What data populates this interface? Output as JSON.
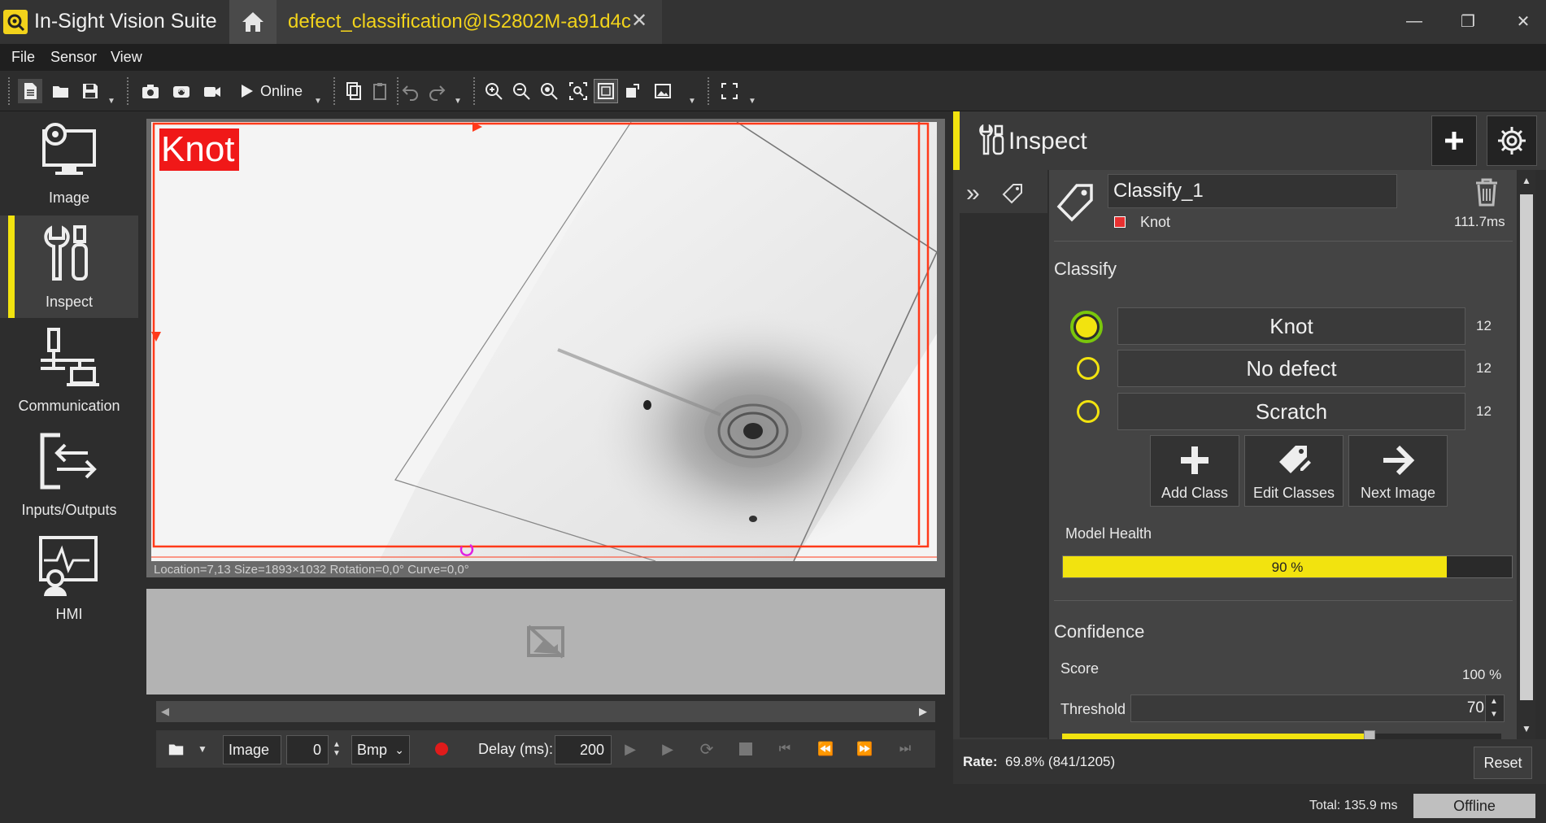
{
  "app": {
    "title": "In-Sight Vision Suite",
    "document_tab": "defect_classification@IS2802M-a91d4c",
    "accent_color": "#f2e30f"
  },
  "menu": {
    "items": [
      "File",
      "Sensor",
      "View"
    ]
  },
  "toolbar": {
    "online_label": "Online",
    "icons": [
      "new-file-icon",
      "open-folder-icon",
      "save-icon",
      "trigger-camera-icon",
      "live-video-icon",
      "record-icon",
      "play-icon",
      "copy-icon",
      "paste-icon",
      "undo-icon",
      "redo-icon",
      "zoom-in-icon",
      "zoom-out-icon",
      "zoom-fit-icon",
      "zoom-selection-icon",
      "zoom-fill-icon",
      "rotate-image-icon",
      "image-icon",
      "fullscreen-icon"
    ]
  },
  "nav": {
    "items": [
      {
        "label": "Image",
        "icon": "monitor-gear-icon",
        "active": false
      },
      {
        "label": "Inspect",
        "icon": "tools-icon",
        "active": true
      },
      {
        "label": "Communication",
        "icon": "network-icon",
        "active": false
      },
      {
        "label": "Inputs/Outputs",
        "icon": "io-arrows-icon",
        "active": false
      },
      {
        "label": "HMI",
        "icon": "hmi-icon",
        "active": false
      }
    ]
  },
  "image_view": {
    "roi_label": "Knot",
    "status_text": "Location=7,13 Size=1893×1032 Rotation=0,0° Curve=0,0°"
  },
  "playback": {
    "source": "Image",
    "index": "0",
    "format": "Bmp",
    "delay_label": "Delay (ms):",
    "delay_value": "200"
  },
  "inspect": {
    "title": "Inspect",
    "tool_name": "Classify_1",
    "result_class": "Knot",
    "result_color": "#e83030",
    "time": "111.7ms",
    "section_title": "Classify",
    "classes": [
      {
        "name": "Knot",
        "count": "12",
        "selected": true
      },
      {
        "name": "No defect",
        "count": "12",
        "selected": false
      },
      {
        "name": "Scratch",
        "count": "12",
        "selected": false
      }
    ],
    "actions": {
      "add_class": "Add Class",
      "edit_classes": "Edit Classes",
      "next_image": "Next Image"
    },
    "model_health_label": "Model Health",
    "model_health_value": 0.9,
    "model_health_text": "90 %",
    "confidence_title": "Confidence",
    "score_label": "Score",
    "score_value": "100 %",
    "threshold_label": "Threshold",
    "threshold_value": "70",
    "threshold_fraction": 0.7
  },
  "rate": {
    "label": "Rate:",
    "value": "69.8% (841/1205)",
    "reset_label": "Reset"
  },
  "status": {
    "total": "Total: 135.9 ms",
    "connection": "Offline"
  }
}
